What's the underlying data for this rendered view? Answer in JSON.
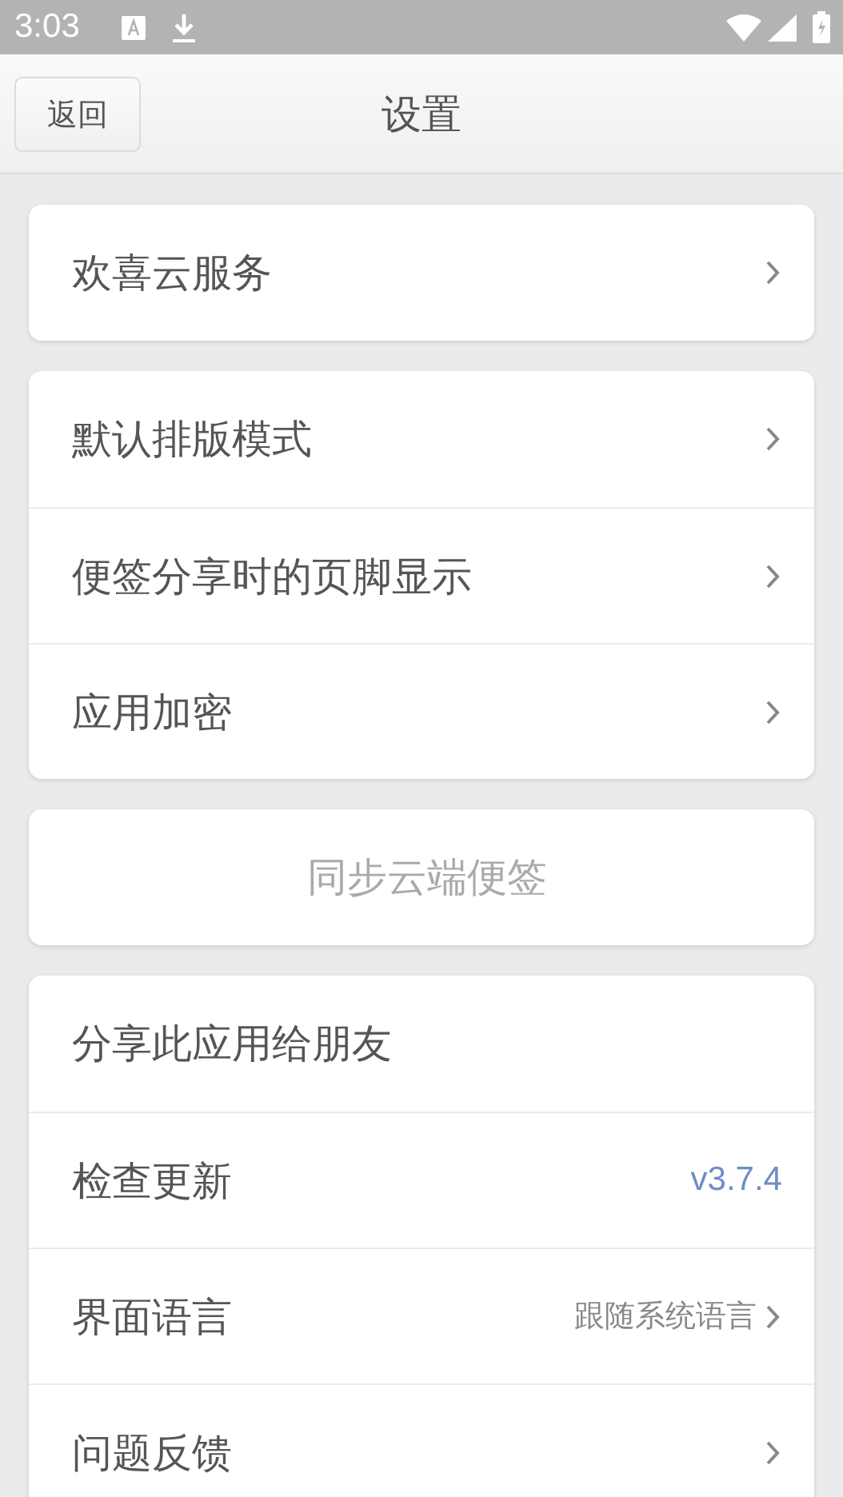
{
  "status_bar": {
    "time": "3:03"
  },
  "header": {
    "back_button": "返回",
    "title": "设置"
  },
  "groups": [
    {
      "items": [
        {
          "kind": "link",
          "label": "欢喜云服务"
        }
      ]
    },
    {
      "items": [
        {
          "kind": "link",
          "label": "默认排版模式"
        },
        {
          "kind": "link",
          "label": "便签分享时的页脚显示"
        },
        {
          "kind": "link",
          "label": "应用加密"
        }
      ]
    },
    {
      "items": [
        {
          "kind": "action",
          "label": "同步云端便签"
        }
      ]
    },
    {
      "items": [
        {
          "kind": "plain",
          "label": "分享此应用给朋友"
        },
        {
          "kind": "version",
          "label": "检查更新",
          "value": "v3.7.4"
        },
        {
          "kind": "choice",
          "label": "界面语言",
          "value": "跟随系统语言"
        },
        {
          "kind": "link",
          "label": "问题反馈"
        }
      ]
    }
  ]
}
